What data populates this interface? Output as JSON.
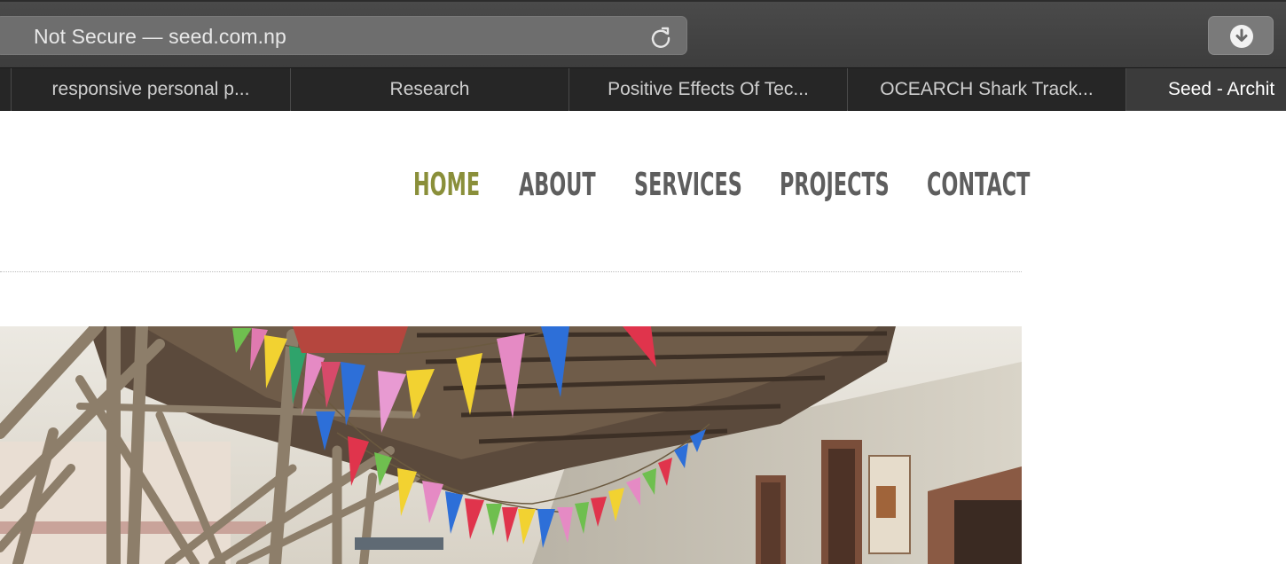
{
  "browser": {
    "address": "Not Secure — seed.com.np",
    "tabs": [
      {
        "label": "responsive personal p..."
      },
      {
        "label": "Research"
      },
      {
        "label": "Positive Effects Of Tec..."
      },
      {
        "label": "OCEARCH Shark Track..."
      },
      {
        "label": "Seed - Archit"
      }
    ]
  },
  "nav": {
    "home": "HOME",
    "about": "ABOUT",
    "services": "SERVICES",
    "projects": "PROJECTS",
    "contact": "CONTACT"
  },
  "colors": {
    "nav_active": "#8a8f3a",
    "nav_default": "#5e5e5e"
  }
}
